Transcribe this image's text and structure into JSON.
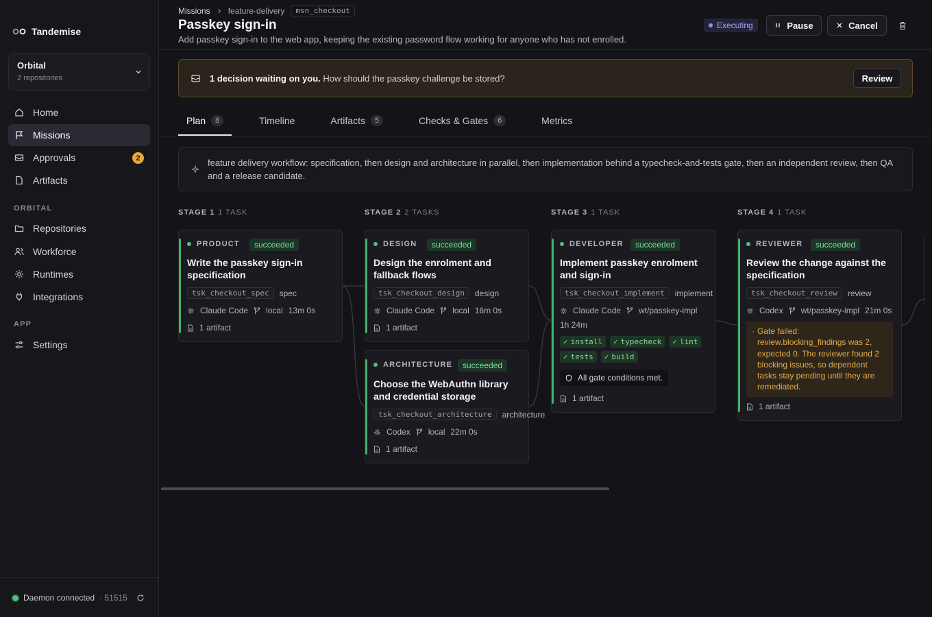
{
  "app": {
    "name": "Tandemise"
  },
  "workspace": {
    "name": "Orbital",
    "sub": "2 repositories"
  },
  "nav": {
    "home": "Home",
    "missions": "Missions",
    "approvals": "Approvals",
    "approvals_badge": "2",
    "artifacts": "Artifacts",
    "section_orbital": "ORBITAL",
    "repositories": "Repositories",
    "workforce": "Workforce",
    "runtimes": "Runtimes",
    "integrations": "Integrations",
    "section_app": "APP",
    "settings": "Settings"
  },
  "footer": {
    "status": "Daemon connected",
    "port": "· 51515"
  },
  "breadcrumb": {
    "root": "Missions",
    "workflow": "feature-delivery",
    "mission_id": "msn_checkout"
  },
  "mission": {
    "title": "Passkey sign-in",
    "description": "Add passkey sign-in to the web app, keeping the existing password flow working for anyone who has not enrolled.",
    "status": "Executing",
    "pause_label": "Pause",
    "cancel_label": "Cancel"
  },
  "banner": {
    "lead": "1 decision waiting on you.",
    "question": "How should the passkey challenge be stored?",
    "action": "Review"
  },
  "tabs": [
    {
      "label": "Plan",
      "count": "8"
    },
    {
      "label": "Timeline",
      "count": ""
    },
    {
      "label": "Artifacts",
      "count": "5"
    },
    {
      "label": "Checks & Gates",
      "count": "6"
    },
    {
      "label": "Metrics",
      "count": ""
    }
  ],
  "workflow_description": "feature delivery workflow: specification, then design and architecture in parallel, then implementation behind a typecheck-and-tests gate, then an independent review, then QA and a release candidate.",
  "stages": [
    {
      "label": "STAGE 1",
      "count": "1 TASK"
    },
    {
      "label": "STAGE 2",
      "count": "2 TASKS"
    },
    {
      "label": "STAGE 3",
      "count": "1 TASK"
    },
    {
      "label": "STAGE 4",
      "count": "1 TASK"
    }
  ],
  "tasks": {
    "spec": {
      "role": "PRODUCT",
      "status": "succeeded",
      "title": "Write the passkey sign-in specification",
      "id": "tsk_checkout_spec",
      "kind": "spec",
      "runtime": "Claude Code",
      "branch": "local",
      "duration": "13m 0s",
      "artifacts": "1 artifact"
    },
    "design": {
      "role": "DESIGN",
      "status": "succeeded",
      "title": "Design the enrolment and fallback flows",
      "id": "tsk_checkout_design",
      "kind": "design",
      "runtime": "Claude Code",
      "branch": "local",
      "duration": "16m 0s",
      "artifacts": "1 artifact"
    },
    "arch": {
      "role": "ARCHITECTURE",
      "status": "succeeded",
      "title": "Choose the WebAuthn library and credential storage",
      "id": "tsk_checkout_architecture",
      "kind": "architecture",
      "runtime": "Codex",
      "branch": "local",
      "duration": "22m 0s",
      "artifacts": "1 artifact"
    },
    "impl": {
      "role": "DEVELOPER",
      "status": "succeeded",
      "title": "Implement passkey enrolment and sign-in",
      "id": "tsk_checkout_implement",
      "kind": "implement",
      "runtime": "Claude Code",
      "branch": "wt/passkey-impl",
      "duration": "1h 24m",
      "checks": [
        "install",
        "typecheck",
        "lint",
        "tests",
        "build"
      ],
      "gate": "All gate conditions met.",
      "artifacts": "1 artifact"
    },
    "review": {
      "role": "REVIEWER",
      "status": "succeeded",
      "title": "Review the change against the specification",
      "id": "tsk_checkout_review",
      "kind": "review",
      "runtime": "Codex",
      "branch": "wt/passkey-impl",
      "duration": "21m 0s",
      "gate_fail": "Gate failed: review.blocking_findings was 2, expected 0. The reviewer found 2 blocking issues, so dependent tasks stay pending until they are remediated.",
      "artifacts": "1 artifact"
    }
  },
  "colors": {
    "accent_green": "#4cc37a",
    "warning": "#e7ac45",
    "status_blue": "#8e8ef5"
  }
}
